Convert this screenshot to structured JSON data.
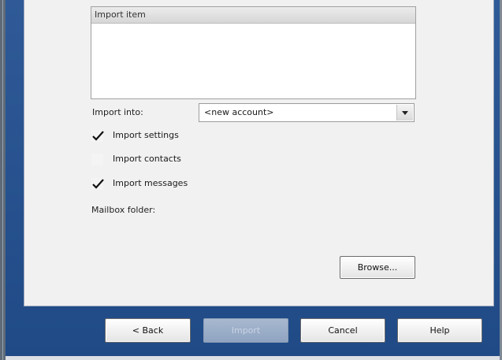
{
  "import_list": {
    "header": "Import item"
  },
  "import_into": {
    "label": "Import into:",
    "selected": "<new account>"
  },
  "options": [
    {
      "label": "Import settings",
      "checked": true
    },
    {
      "label": "Import contacts",
      "checked": false
    },
    {
      "label": "Import messages",
      "checked": true
    }
  ],
  "mailbox_folder": {
    "label": "Mailbox folder:"
  },
  "browse_label": "Browse...",
  "buttons": {
    "back": "< Back",
    "import": "Import",
    "cancel": "Cancel",
    "help": "Help"
  }
}
